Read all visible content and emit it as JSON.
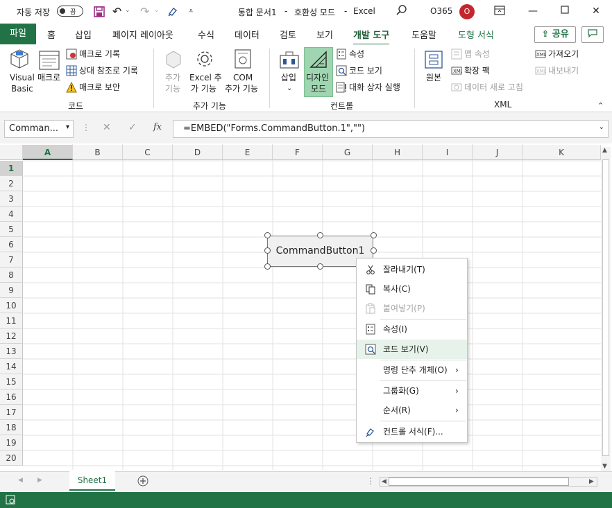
{
  "title_bar": {
    "autosave_label": "자동 저장",
    "autosave_state": "끔",
    "doc_title": "통합 문서1",
    "separator1": "-",
    "compat_mode": "호환성 모드",
    "separator2": "-",
    "app_name": "Excel",
    "account": "O365",
    "avatar_initial": "O"
  },
  "tabs": {
    "file": "파일",
    "items": [
      "홈",
      "삽입",
      "페이지 레이아웃",
      "수식",
      "데이터",
      "검토",
      "보기",
      "개발 도구",
      "도움말",
      "도형 서식"
    ],
    "share": "공유"
  },
  "ribbon": {
    "code_group": {
      "visual_basic": [
        "Visual",
        "Basic"
      ],
      "macro": "매크로",
      "record_macro": "매크로 기록",
      "relative_ref": "상대 참조로 기록",
      "macro_security": "매크로 보안",
      "group_label": "코드"
    },
    "addins_group": {
      "addins": [
        "추가",
        "기능"
      ],
      "excel_addins": [
        "Excel 추",
        "가 기능"
      ],
      "com_addins": [
        "COM",
        "추가 기능"
      ],
      "group_label": "추가 기능"
    },
    "controls_group": {
      "insert": "삽입",
      "design_mode": [
        "디자인",
        "모드"
      ],
      "properties": "속성",
      "view_code": "코드 보기",
      "run_dialog": "대화 상자 실행",
      "group_label": "컨트롤"
    },
    "xml_group": {
      "source": "원본",
      "map_properties": "맵 속성",
      "expansion_packs": "확장 팩",
      "refresh_data": "데이터 새로 고침",
      "import": "가져오기",
      "export": "내보내기",
      "group_label": "XML"
    }
  },
  "formula_bar": {
    "name_box": "Comman...",
    "fx": "fx",
    "formula": "=EMBED(\"Forms.CommandButton.1\",\"\")"
  },
  "grid": {
    "columns": [
      "A",
      "B",
      "C",
      "D",
      "E",
      "F",
      "G",
      "H",
      "I",
      "J",
      "K"
    ],
    "rows": [
      "1",
      "2",
      "3",
      "4",
      "5",
      "6",
      "7",
      "8",
      "9",
      "10",
      "11",
      "12",
      "13",
      "14",
      "15",
      "16",
      "17",
      "18",
      "19",
      "20"
    ],
    "selected_column": "A",
    "selected_row": "1"
  },
  "command_button": {
    "label": "CommandButton1"
  },
  "context_menu": {
    "items": [
      {
        "label": "잘라내기(T)",
        "icon": "scissors-icon",
        "enabled": true
      },
      {
        "label": "복사(C)",
        "icon": "copy-icon",
        "enabled": true
      },
      {
        "label": "붙여넣기(P)",
        "icon": "paste-icon",
        "enabled": false
      },
      {
        "label": "속성(I)",
        "icon": "properties-icon",
        "enabled": true
      },
      {
        "label": "코드 보기(V)",
        "icon": "view-code-icon",
        "enabled": true,
        "highlighted": true
      },
      {
        "label": "명령 단추 개체(O)",
        "submenu": true
      },
      {
        "label": "그룹화(G)",
        "submenu": true
      },
      {
        "label": "순서(R)",
        "submenu": true
      },
      {
        "label": "컨트롤 서식(F)...",
        "icon": "format-brush-icon",
        "enabled": true
      }
    ]
  },
  "sheets": {
    "active": "Sheet1"
  },
  "colors": {
    "accent": "#217346",
    "highlight": "#e6f2ea",
    "avatar": "#c4262e"
  }
}
